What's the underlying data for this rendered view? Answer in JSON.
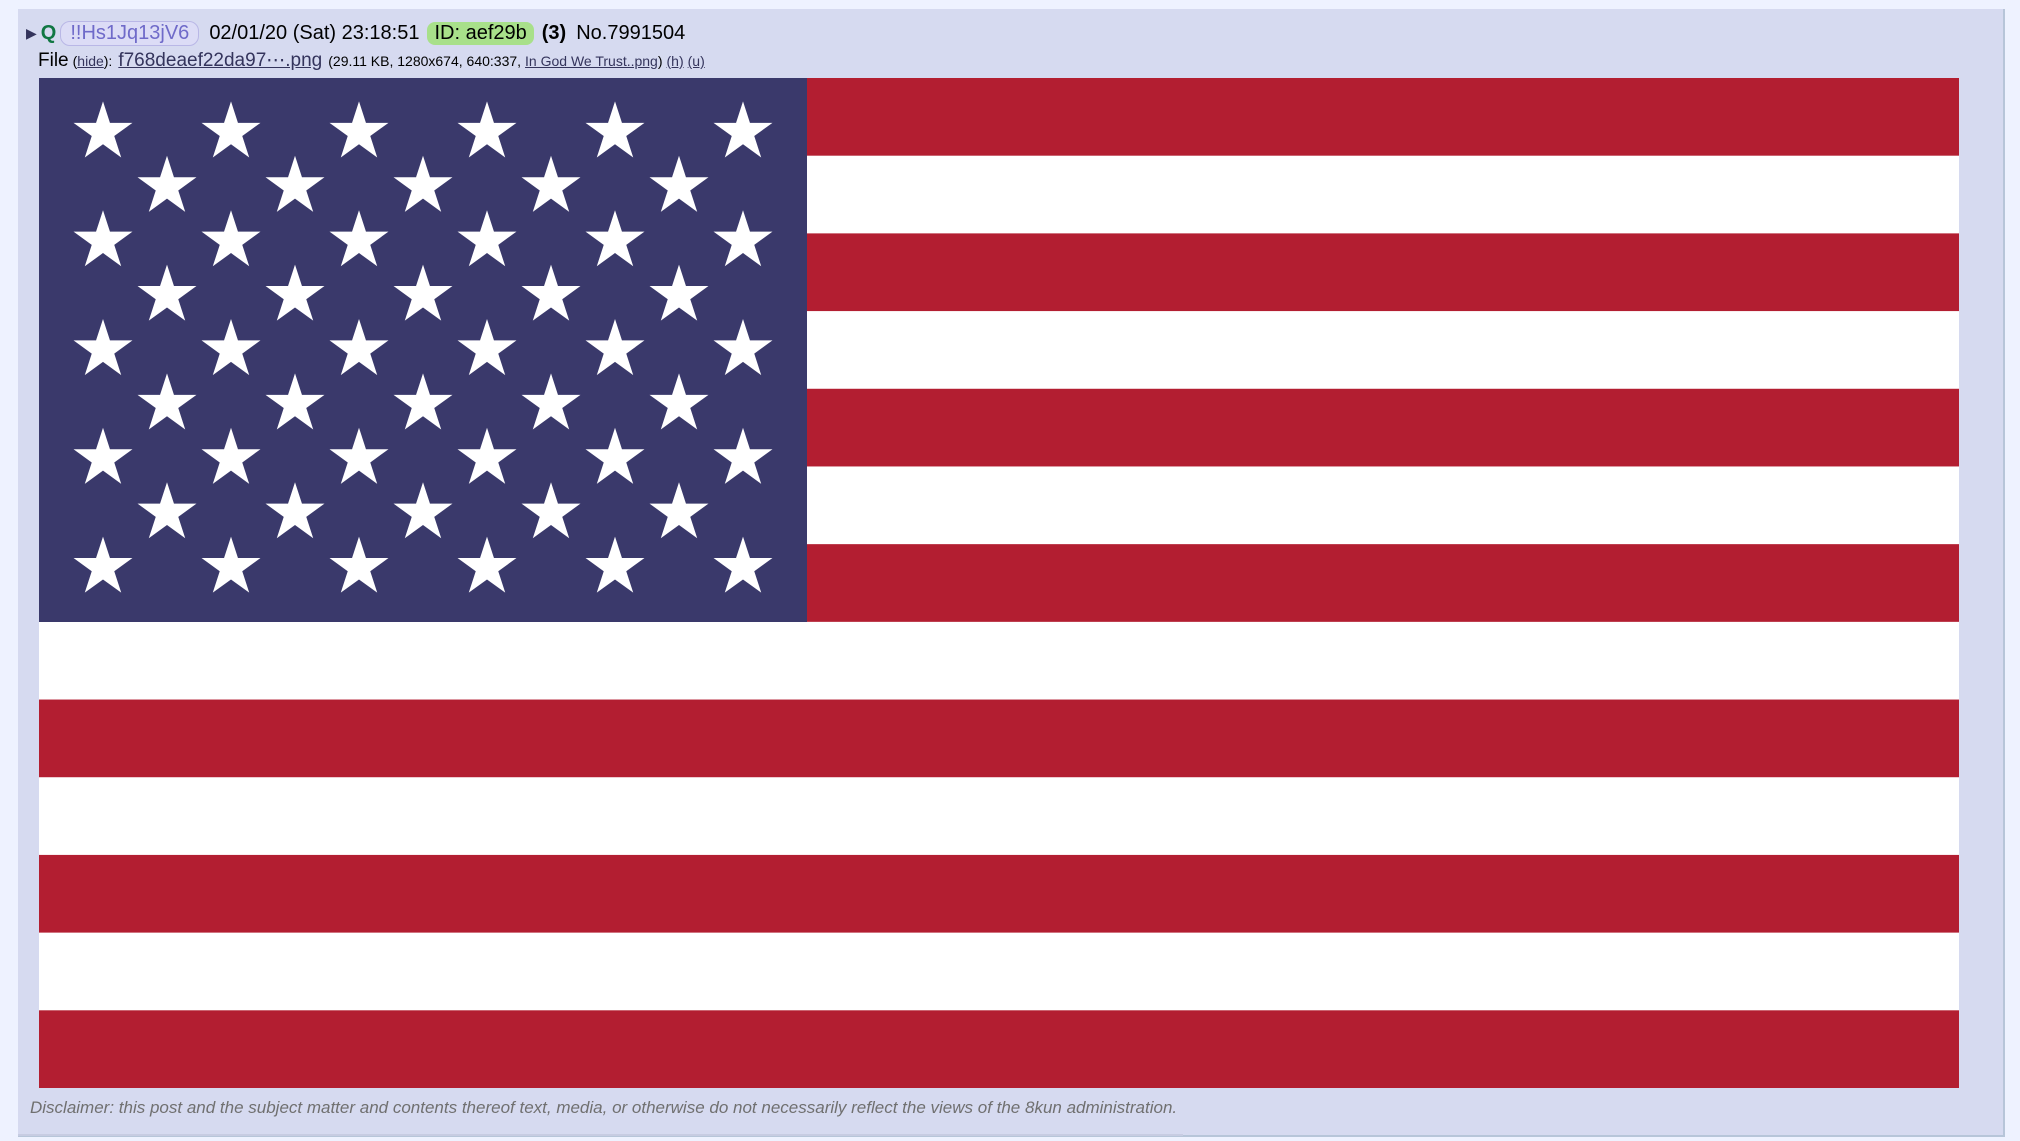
{
  "post": {
    "arrow": "▶",
    "name": "Q",
    "tripcode": "!!Hs1Jq13jV6",
    "datetime": "02/01/20 (Sat) 23:18:51",
    "id_label": "ID: aef29b",
    "reply_count": "(3)",
    "post_number": "No.7991504"
  },
  "file": {
    "label": "File",
    "hide_open": "(",
    "hide_link": "hide",
    "hide_close": "):",
    "filename": "f768deaef22da97⋯.png",
    "meta_prefix": "(29.11 KB, 1280x674, 640:337,",
    "original_name": "In God We Trust..png",
    "meta_suffix": ")",
    "h_link": "(h)",
    "u_link": "(u)"
  },
  "image": {
    "description_icon": "us-flag-image",
    "colors": {
      "red": "#b31e31",
      "white": "#ffffff",
      "blue": "#3a396b"
    }
  },
  "disclaimer": "Disclaimer: this post and the subject matter and contents thereof   text, media, or otherwise   do not necessarily reflect the views of the 8kun administration."
}
